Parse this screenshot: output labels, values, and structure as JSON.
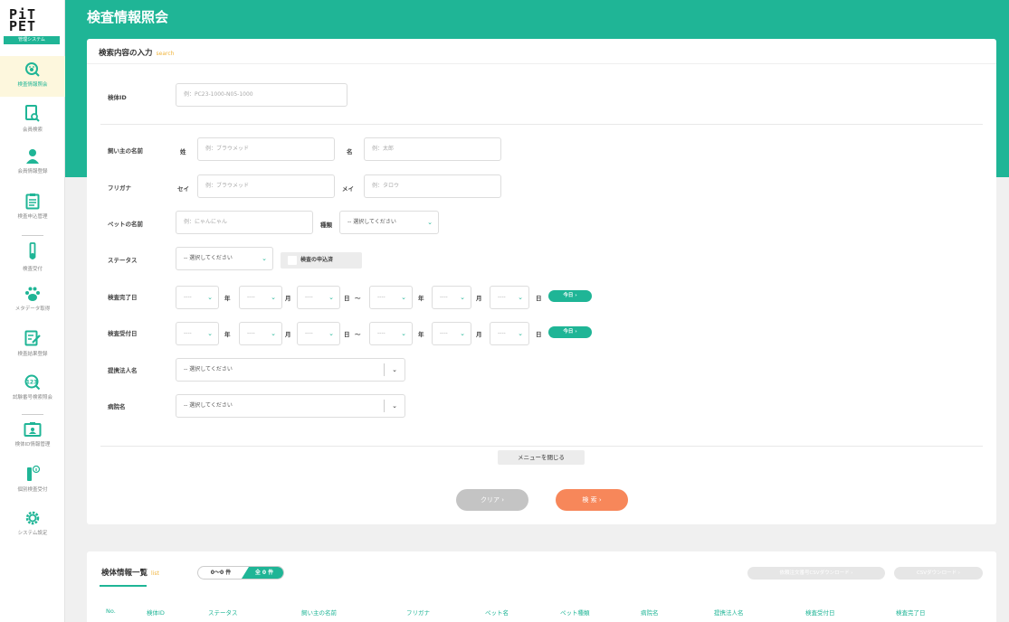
{
  "app": {
    "logo_line1": "PiT",
    "logo_line2": "PET",
    "logo_badge": "管理システム",
    "page_title": "検査情報照会"
  },
  "sidebar": {
    "items": [
      {
        "label": "検査情報照会",
        "icon": "search-paw-icon",
        "active": true
      },
      {
        "label": "会員検索",
        "icon": "document-search-icon"
      },
      {
        "label": "会員情報登録",
        "icon": "person-icon"
      },
      {
        "label": "検査申込管理",
        "icon": "clipboard-icon"
      },
      {
        "label": "検査受付",
        "icon": "test-tube-icon"
      },
      {
        "label": "メタデータ取得",
        "icon": "paw-icon"
      },
      {
        "label": "検査結果登録",
        "icon": "edit-document-icon"
      },
      {
        "label": "試験番号検索照会",
        "icon": "number-search-icon"
      },
      {
        "label": "検体ID情報管理",
        "icon": "id-card-icon"
      },
      {
        "label": "個別検査受付",
        "icon": "test-tube-info-icon"
      },
      {
        "label": "システム設定",
        "icon": "gear-icon"
      }
    ]
  },
  "search": {
    "title": "検索内容の入力",
    "title_en": "search",
    "specimen_id": {
      "label": "検体ID",
      "placeholder": "例：PC23-1000-N05-1000"
    },
    "owner_name": {
      "label": "飼い主の名前",
      "sei_label": "姓",
      "sei_placeholder": "例：ブラウメッド",
      "mei_label": "名",
      "mei_placeholder": "例：太郎"
    },
    "furigana": {
      "label": "フリガナ",
      "sei_label": "セイ",
      "sei_placeholder": "例：ブラウメッド",
      "mei_label": "メイ",
      "mei_placeholder": "例：タロウ"
    },
    "pet_name": {
      "label": "ペットの名前",
      "placeholder": "例：にゃんにゃん",
      "kind_label": "種類",
      "kind_value": "-- 選択してください"
    },
    "status": {
      "label": "ステータス",
      "value": "-- 選択してください",
      "checkbox_label": "検査の申込済"
    },
    "completed_date": {
      "label": "検査完了日",
      "today": "今日 ›"
    },
    "received_date": {
      "label": "検査受付日",
      "today": "今日 ›"
    },
    "date_placeholder": "----",
    "date_units": {
      "year": "年",
      "month": "月",
      "day": "日",
      "tilde": "〜"
    },
    "partner": {
      "label": "提携法人名",
      "value": "-- 選択してください"
    },
    "hospital": {
      "label": "病院名",
      "value": "-- 選択してください"
    },
    "menu_close": "メニューを閉じる",
    "clear_button": "クリア ›",
    "search_button": "検 索 ›"
  },
  "list": {
    "title": "検体情報一覧",
    "title_en": "list",
    "range": "0〜0 件",
    "total": "全 0 件",
    "download_order": "依頼注文番号CSVダウンロード ›",
    "download_csv": "CSVダウンロード ›",
    "columns": [
      "No.",
      "検体ID",
      "ステータス",
      "飼い主の名前",
      "フリガナ",
      "ペット名",
      "ペット種類",
      "病院名",
      "提携法人名",
      "検査受付日",
      "検査完了日"
    ]
  },
  "colors": {
    "accent": "#1fb596",
    "search_button": "#f7875a",
    "clear_button": "#c4c4c4",
    "highlight": "#f0b43c"
  }
}
